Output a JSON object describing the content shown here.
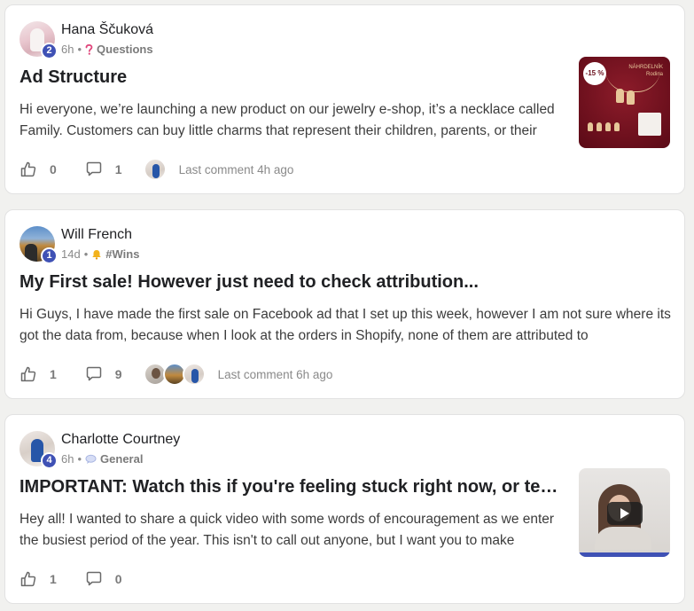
{
  "posts": [
    {
      "author": "Hana Ščuková",
      "level": "2",
      "time": "6h",
      "category": "Questions",
      "category_icon": "question-icon",
      "title": "Ad Structure",
      "body": "Hi everyone, we’re launching a new product on our jewelry e-shop, it’s a necklace called Family. Customers can buy little charms that represent their children, parents, or their",
      "likes": "0",
      "comments": "1",
      "last_comment": "Last comment 4h ago",
      "thumbnail": {
        "type": "image",
        "discount": "-15 %",
        "caption_line1": "NÁHRDELNÍK",
        "caption_line2": "Rodina"
      }
    },
    {
      "author": "Will French",
      "level": "1",
      "time": "14d",
      "category": "#Wins",
      "category_icon": "bell-icon",
      "title": "My First sale! However just need to check attribution...",
      "body": "Hi Guys, I have made the first sale on Facebook ad that I set up this week, however I am not sure where its got the data from, because when I look at the orders in Shopify, none of them are attributed to",
      "likes": "1",
      "comments": "9",
      "last_comment": "Last comment 6h ago"
    },
    {
      "author": "Charlotte Courtney",
      "level": "4",
      "time": "6h",
      "category": "General",
      "category_icon": "speech-bubble-icon",
      "title": "IMPORTANT: Watch this if you're feeling stuck right now, or tempte…",
      "body": "Hey all! I wanted to share a quick video with some words of encouragement as we enter the busiest period of the year. This isn't to call out anyone, but I want you to make",
      "likes": "1",
      "comments": "0",
      "thumbnail": {
        "type": "video"
      }
    }
  ],
  "colors": {
    "level_badge": "#3f51b5",
    "background": "#f1f1ef",
    "card": "#ffffff"
  }
}
